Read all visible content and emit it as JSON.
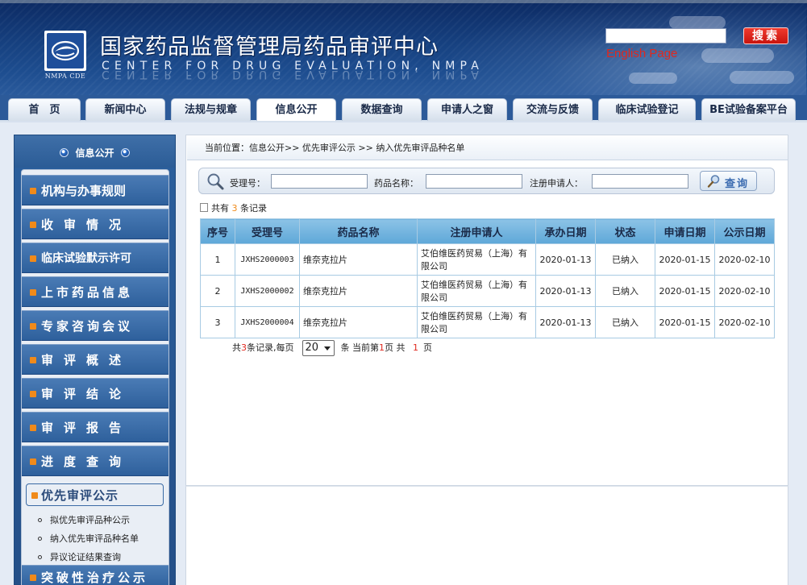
{
  "header": {
    "logo_caption": "NMPA CDE",
    "title": "国家药品监督管理局药品审评中心",
    "subtitle": "CENTER FOR DRUG EVALUATION, NMPA",
    "search_placeholder": "",
    "search_button": "搜索",
    "english_link": "English Page"
  },
  "nav": {
    "tabs": [
      {
        "label": "首　页"
      },
      {
        "label": "新闻中心"
      },
      {
        "label": "法规与规章"
      },
      {
        "label": "信息公开",
        "active": true
      },
      {
        "label": "数据查询"
      },
      {
        "label": "申请人之窗"
      },
      {
        "label": "交流与反馈"
      },
      {
        "label": "临床试验登记"
      },
      {
        "label": "BE试验备案平台"
      }
    ]
  },
  "sidebar": {
    "header": "信息公开",
    "items": [
      {
        "label": "机构与办事规则"
      },
      {
        "label": "收审情况"
      },
      {
        "label": "临床试验默示许可"
      },
      {
        "label": "上市药品信息"
      },
      {
        "label": "专家咨询会议"
      },
      {
        "label": "审评概述"
      },
      {
        "label": "审评结论"
      },
      {
        "label": "审评报告"
      },
      {
        "label": "进度查询"
      },
      {
        "label": "优先审评公示"
      },
      {
        "label": "突破性治疗公示"
      }
    ],
    "sub_items": [
      {
        "label": "拟优先审评品种公示"
      },
      {
        "label": "纳入优先审评品种名单"
      },
      {
        "label": "异议论证结果查询"
      }
    ]
  },
  "content": {
    "breadcrumb": "当前位置：信息公开>> 优先审评公示 >> 纳入优先审评品种名单",
    "query": {
      "accept_label": "受理号：",
      "drug_label": "药品名称：",
      "applicant_label": "注册申请人：",
      "accept_value": "",
      "drug_value": "",
      "applicant_value": "",
      "button": "查询"
    },
    "record_prefix": "共有",
    "record_count": "3",
    "record_suffix": "条记录",
    "table": {
      "headers": [
        "序号",
        "受理号",
        "药品名称",
        "注册申请人",
        "承办日期",
        "状态",
        "申请日期",
        "公示日期"
      ],
      "rows": [
        [
          "1",
          "JXHS2000003",
          "维奈克拉片",
          "艾伯维医药贸易（上海）有限公司",
          "2020-01-13",
          "已纳入",
          "2020-01-15",
          "2020-02-10"
        ],
        [
          "2",
          "JXHS2000002",
          "维奈克拉片",
          "艾伯维医药贸易（上海）有限公司",
          "2020-01-13",
          "已纳入",
          "2020-01-15",
          "2020-02-10"
        ],
        [
          "3",
          "JXHS2000004",
          "维奈克拉片",
          "艾伯维医药贸易（上海）有限公司",
          "2020-01-13",
          "已纳入",
          "2020-01-15",
          "2020-02-10"
        ]
      ]
    },
    "pagination": {
      "text_total_prefix": "共",
      "total": "3",
      "text_total_suffix": "条记录,每页",
      "per_page": "20",
      "text_current_prefix": "条 当前第",
      "current": "1",
      "text_current_suffix": "页 共",
      "pages": "1",
      "text_pages_suffix": "页"
    }
  },
  "colors": {
    "header_bg": "#16407f",
    "accent_red": "#e0281e",
    "table_header": "#6fb1de",
    "sidebar_bg": "#2b5f9d"
  }
}
